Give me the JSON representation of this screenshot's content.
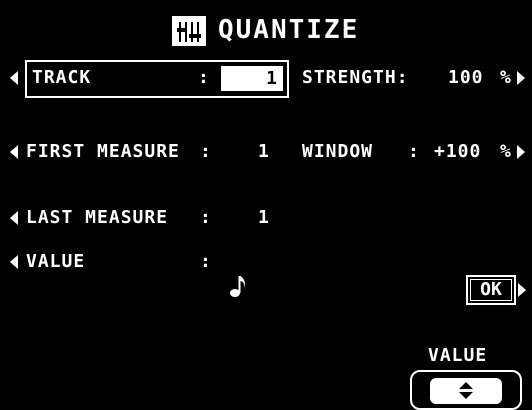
{
  "header": {
    "title": "QUANTIZE",
    "icon": "sequencer-icon"
  },
  "rows": {
    "track": {
      "label": "TRACK",
      "sep": ":",
      "value": "1"
    },
    "first_measure": {
      "label": "FIRST MEASURE",
      "sep": ":",
      "value": "1"
    },
    "last_measure": {
      "label": "LAST MEASURE",
      "sep": ":",
      "value": "1"
    },
    "value": {
      "label": "VALUE",
      "sep": ":",
      "note_icon": "eighth-note-icon"
    },
    "strength": {
      "label": "STRENGTH:",
      "value": "100",
      "unit": "%"
    },
    "window": {
      "label": "WINDOW",
      "sep": ":",
      "value": "+100",
      "unit": "%"
    }
  },
  "ok_label": "OK",
  "value_control": {
    "label": "VALUE"
  },
  "colors": {
    "background": "#000000",
    "foreground": "#ffffff"
  }
}
